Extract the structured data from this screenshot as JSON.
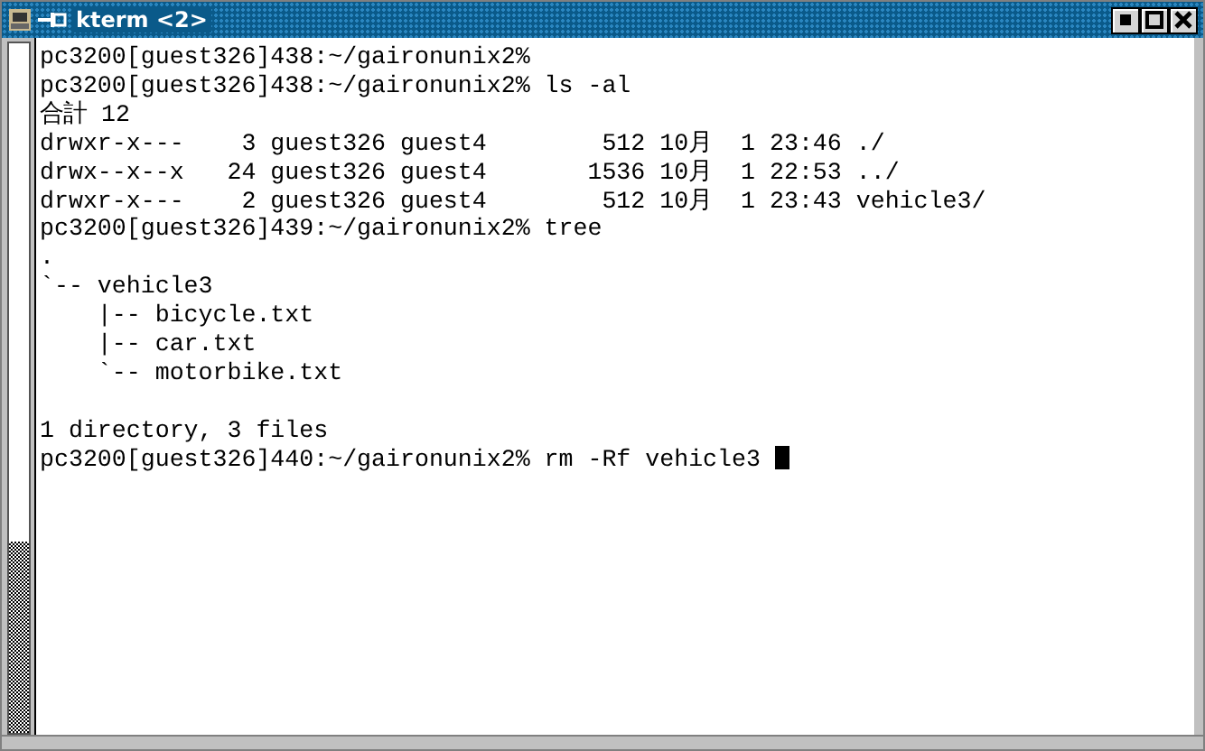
{
  "window": {
    "title": "kterm <2>"
  },
  "terminal": {
    "lines": [
      {
        "text": "pc3200[guest326]438:~/gaironunix2%",
        "gap_before": false
      },
      {
        "text": "pc3200[guest326]438:~/gaironunix2% ls -al",
        "gap_before": false
      },
      {
        "text": "合計 12",
        "gap_before": false
      },
      {
        "text": "drwxr-x---    3 guest326 guest4        512 10月  1 23:46 ./",
        "gap_before": false
      },
      {
        "text": "drwx--x--x   24 guest326 guest4       1536 10月  1 22:53 ../",
        "gap_before": false
      },
      {
        "text": "drwxr-x---    2 guest326 guest4        512 10月  1 23:43 vehicle3/",
        "gap_before": false
      },
      {
        "text": "pc3200[guest326]439:~/gaironunix2% tree",
        "gap_before": false
      },
      {
        "text": ".",
        "gap_before": false
      },
      {
        "text": "`-- vehicle3",
        "gap_before": false
      },
      {
        "text": "    |-- bicycle.txt",
        "gap_before": false
      },
      {
        "text": "    |-- car.txt",
        "gap_before": false
      },
      {
        "text": "    `-- motorbike.txt",
        "gap_before": false
      },
      {
        "text": "1 directory, 3 files",
        "gap_before": true
      },
      {
        "text": "pc3200[guest326]440:~/gaironunix2% rm -Rf vehicle3",
        "gap_before": false,
        "cursor": true
      }
    ]
  }
}
